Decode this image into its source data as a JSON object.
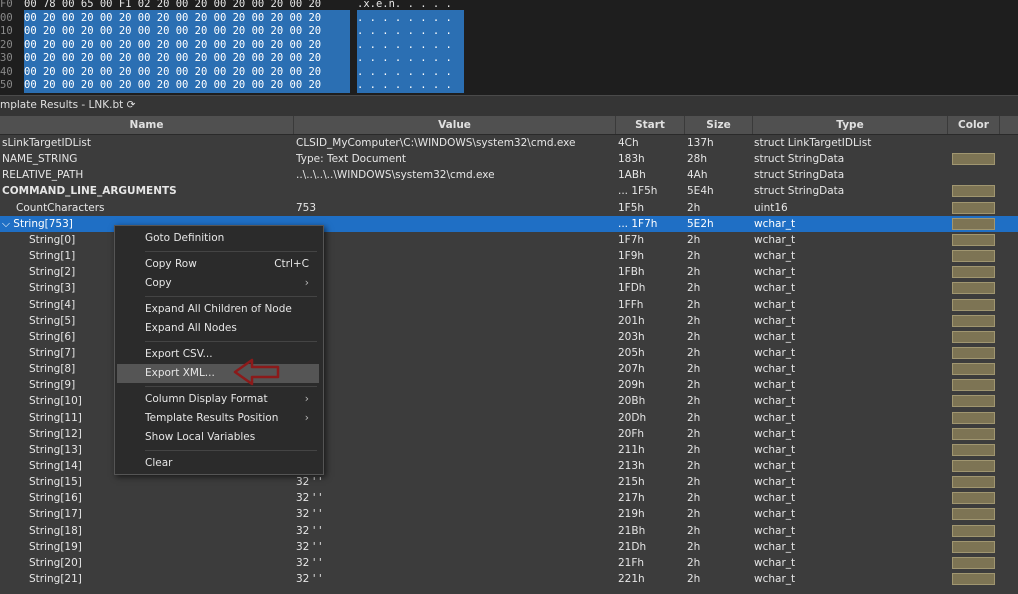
{
  "hex": {
    "rows": [
      {
        "offset": "F0",
        "bytes": "00 78 00 65 00 F1 02 20 00 20 00 20 00 20 00 20",
        "ascii": ".x.e.ñ. . . . ."
      },
      {
        "offset": "00",
        "bytes": "00 20 00 20 00 20 00 20 00 20 00 20 00 20 00 20",
        "ascii": ". . . . . . . ."
      },
      {
        "offset": "10",
        "bytes": "00 20 00 20 00 20 00 20 00 20 00 20 00 20 00 20",
        "ascii": ". . . . . . . ."
      },
      {
        "offset": "20",
        "bytes": "00 20 00 20 00 20 00 20 00 20 00 20 00 20 00 20",
        "ascii": ". . . . . . . ."
      },
      {
        "offset": "30",
        "bytes": "00 20 00 20 00 20 00 20 00 20 00 20 00 20 00 20",
        "ascii": ". . . . . . . ."
      },
      {
        "offset": "40",
        "bytes": "00 20 00 20 00 20 00 20 00 20 00 20 00 20 00 20",
        "ascii": ". . . . . . . ."
      },
      {
        "offset": "50",
        "bytes": "00 20 00 20 00 20 00 20 00 20 00 20 00 20 00 20",
        "ascii": ". . . . . . . ."
      }
    ]
  },
  "panel": {
    "title": "mplate Results - LNK.bt ⟳"
  },
  "columns": {
    "name": "Name",
    "value": "Value",
    "start": "Start",
    "size": "Size",
    "type": "Type",
    "color": "Color"
  },
  "rows": [
    {
      "name": "sLinkTargetIDList",
      "value": "CLSID_MyComputer\\C:\\WINDOWS\\system32\\cmd.exe",
      "start": "4Ch",
      "size": "137h",
      "type": "struct LinkTargetIDList",
      "color": false,
      "bold": false,
      "indent": 0
    },
    {
      "name": "NAME_STRING",
      "value": "Type: Text Document",
      "start": "183h",
      "size": "28h",
      "type": "struct StringData",
      "color": true,
      "bold": false,
      "indent": 0
    },
    {
      "name": "RELATIVE_PATH",
      "value": "..\\..\\..\\..\\WINDOWS\\system32\\cmd.exe",
      "start": "1ABh",
      "size": "4Ah",
      "type": "struct StringData",
      "color": false,
      "bold": false,
      "indent": 0
    },
    {
      "name": "COMMAND_LINE_ARGUMENTS",
      "value": "",
      "start": "... 1F5h",
      "size": "5E4h",
      "type": "struct StringData",
      "color": true,
      "bold": true,
      "indent": 0
    },
    {
      "name": "CountCharacters",
      "value": "753",
      "start": "1F5h",
      "size": "2h",
      "type": "uint16",
      "color": true,
      "bold": false,
      "indent": 1
    },
    {
      "name": "⌵ String[753]",
      "value": "",
      "start": "... 1F7h",
      "size": "5E2h",
      "type": "wchar_t",
      "color": true,
      "bold": false,
      "indent": 0,
      "selected": true
    },
    {
      "name": "String[0]",
      "value": "",
      "start": "1F7h",
      "size": "2h",
      "type": "wchar_t",
      "color": true,
      "indent": 2
    },
    {
      "name": "String[1]",
      "value": "",
      "start": "1F9h",
      "size": "2h",
      "type": "wchar_t",
      "color": true,
      "indent": 2
    },
    {
      "name": "String[2]",
      "value": "",
      "start": "1FBh",
      "size": "2h",
      "type": "wchar_t",
      "color": true,
      "indent": 2
    },
    {
      "name": "String[3]",
      "value": "",
      "start": "1FDh",
      "size": "2h",
      "type": "wchar_t",
      "color": true,
      "indent": 2
    },
    {
      "name": "String[4]",
      "value": "",
      "start": "1FFh",
      "size": "2h",
      "type": "wchar_t",
      "color": true,
      "indent": 2
    },
    {
      "name": "String[5]",
      "value": "",
      "start": "201h",
      "size": "2h",
      "type": "wchar_t",
      "color": true,
      "indent": 2
    },
    {
      "name": "String[6]",
      "value": "",
      "start": "203h",
      "size": "2h",
      "type": "wchar_t",
      "color": true,
      "indent": 2
    },
    {
      "name": "String[7]",
      "value": "",
      "start": "205h",
      "size": "2h",
      "type": "wchar_t",
      "color": true,
      "indent": 2
    },
    {
      "name": "String[8]",
      "value": "",
      "start": "207h",
      "size": "2h",
      "type": "wchar_t",
      "color": true,
      "indent": 2
    },
    {
      "name": "String[9]",
      "value": "",
      "start": "209h",
      "size": "2h",
      "type": "wchar_t",
      "color": true,
      "indent": 2
    },
    {
      "name": "String[10]",
      "value": "",
      "start": "20Bh",
      "size": "2h",
      "type": "wchar_t",
      "color": true,
      "indent": 2
    },
    {
      "name": "String[11]",
      "value": "",
      "start": "20Dh",
      "size": "2h",
      "type": "wchar_t",
      "color": true,
      "indent": 2
    },
    {
      "name": "String[12]",
      "value": "",
      "start": "20Fh",
      "size": "2h",
      "type": "wchar_t",
      "color": true,
      "indent": 2
    },
    {
      "name": "String[13]",
      "value": "",
      "start": "211h",
      "size": "2h",
      "type": "wchar_t",
      "color": true,
      "indent": 2
    },
    {
      "name": "String[14]",
      "value": "",
      "start": "213h",
      "size": "2h",
      "type": "wchar_t",
      "color": true,
      "indent": 2
    },
    {
      "name": "String[15]",
      "value": "32 ' '",
      "start": "215h",
      "size": "2h",
      "type": "wchar_t",
      "color": true,
      "indent": 2
    },
    {
      "name": "String[16]",
      "value": "32 ' '",
      "start": "217h",
      "size": "2h",
      "type": "wchar_t",
      "color": true,
      "indent": 2
    },
    {
      "name": "String[17]",
      "value": "32 ' '",
      "start": "219h",
      "size": "2h",
      "type": "wchar_t",
      "color": true,
      "indent": 2
    },
    {
      "name": "String[18]",
      "value": "32 ' '",
      "start": "21Bh",
      "size": "2h",
      "type": "wchar_t",
      "color": true,
      "indent": 2
    },
    {
      "name": "String[19]",
      "value": "32 ' '",
      "start": "21Dh",
      "size": "2h",
      "type": "wchar_t",
      "color": true,
      "indent": 2
    },
    {
      "name": "String[20]",
      "value": "32 ' '",
      "start": "21Fh",
      "size": "2h",
      "type": "wchar_t",
      "color": true,
      "indent": 2
    },
    {
      "name": "String[21]",
      "value": "32 ' '",
      "start": "221h",
      "size": "2h",
      "type": "wchar_t",
      "color": true,
      "indent": 2
    }
  ],
  "context_menu": {
    "items": [
      {
        "label": "Goto Definition",
        "shortcut": "",
        "submenu": false
      },
      {
        "sep": true
      },
      {
        "label": "Copy Row",
        "shortcut": "Ctrl+C",
        "submenu": false
      },
      {
        "label": "Copy",
        "shortcut": "",
        "submenu": true
      },
      {
        "sep": true
      },
      {
        "label": "Expand All Children of Node",
        "shortcut": "",
        "submenu": false
      },
      {
        "label": "Expand All Nodes",
        "shortcut": "",
        "submenu": false
      },
      {
        "sep": true
      },
      {
        "label": "Export CSV...",
        "shortcut": "",
        "submenu": false
      },
      {
        "label": "Export XML...",
        "shortcut": "",
        "submenu": false,
        "hover": true
      },
      {
        "sep": true
      },
      {
        "label": "Column Display Format",
        "shortcut": "",
        "submenu": true
      },
      {
        "label": "Template Results Position",
        "shortcut": "",
        "submenu": true
      },
      {
        "label": "Show Local Variables",
        "shortcut": "",
        "submenu": false
      },
      {
        "sep": true
      },
      {
        "label": "Clear",
        "shortcut": "",
        "submenu": false
      }
    ]
  },
  "colors": {
    "selection": "#1f6fc5",
    "swatch": "#7d7454",
    "arrow": "#8b1a1a"
  }
}
